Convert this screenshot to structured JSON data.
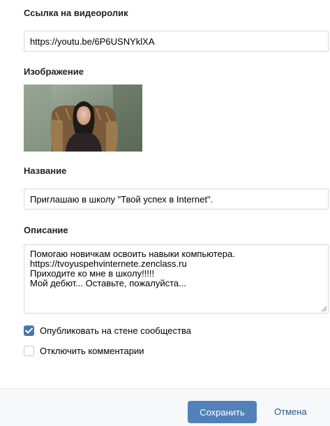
{
  "video_link": {
    "label": "Ссылка на видеоролик",
    "value": "https://youtu.be/6P6USNYklXA"
  },
  "image": {
    "label": "Изображение"
  },
  "title": {
    "label": "Название",
    "value": "Приглашаю в школу \"Твой успех в Internet\"."
  },
  "description": {
    "label": "Описание",
    "value": "Помогаю новичкам освоить навыки компьютера.\nhttps://tvoyuspehvinternete.zenclass.ru\nПриходите ко мне в школу!!!!!\nМой дебют... Оставьте, пожалуйста..."
  },
  "options": {
    "publish_on_wall": {
      "label": "Опубликовать на стене сообщества",
      "checked": true
    },
    "disable_comments": {
      "label": "Отключить комментарии",
      "checked": false
    }
  },
  "footer": {
    "save_label": "Сохранить",
    "cancel_label": "Отмена"
  },
  "colors": {
    "accent": "#5181b8",
    "checkbox_checked": "#4a76a8",
    "link": "#2a5885",
    "footer_bg": "#f7f8fa"
  }
}
